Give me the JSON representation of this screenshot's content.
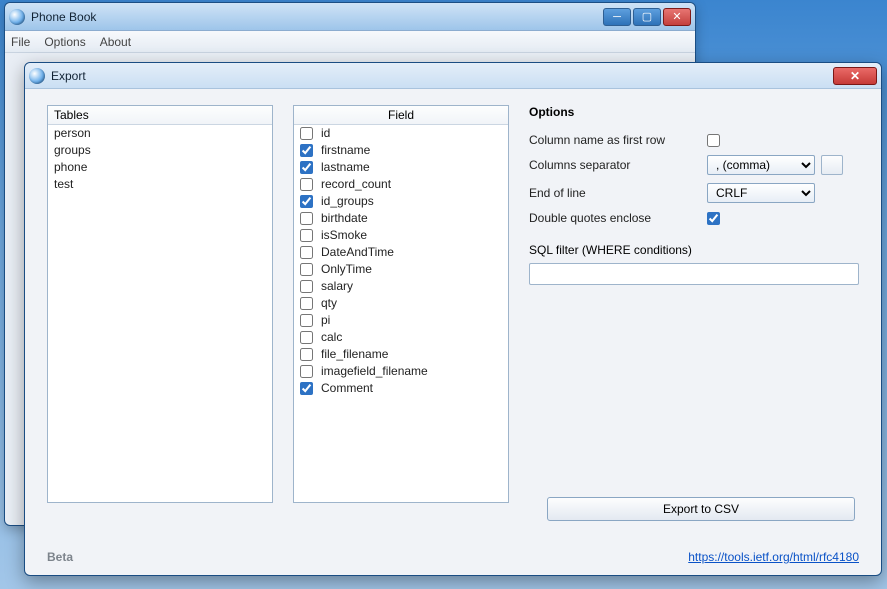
{
  "parent": {
    "title": "Phone Book",
    "menu": [
      "File",
      "Options",
      "About"
    ]
  },
  "dialog": {
    "title": "Export",
    "tables_header": "Tables",
    "fields_header": "Field",
    "tables": [
      "person",
      "groups",
      "phone",
      "test"
    ],
    "fields": [
      {
        "label": "id",
        "checked": false
      },
      {
        "label": "firstname",
        "checked": true
      },
      {
        "label": "lastname",
        "checked": true
      },
      {
        "label": "record_count",
        "checked": false
      },
      {
        "label": "id_groups",
        "checked": true
      },
      {
        "label": "birthdate",
        "checked": false
      },
      {
        "label": "isSmoke",
        "checked": false
      },
      {
        "label": "DateAndTime",
        "checked": false
      },
      {
        "label": "OnlyTime",
        "checked": false
      },
      {
        "label": "salary",
        "checked": false
      },
      {
        "label": "qty",
        "checked": false
      },
      {
        "label": "pi",
        "checked": false
      },
      {
        "label": "calc",
        "checked": false
      },
      {
        "label": "file_filename",
        "checked": false
      },
      {
        "label": "imagefield_filename",
        "checked": false
      },
      {
        "label": "Comment",
        "checked": true
      }
    ],
    "options": {
      "heading": "Options",
      "first_row": {
        "label": "Column name as first row",
        "checked": false
      },
      "separator": {
        "label": "Columns separator",
        "value": ", (comma)"
      },
      "eol": {
        "label": "End of line",
        "value": "CRLF"
      },
      "dquote": {
        "label": "Double quotes enclose",
        "checked": true
      },
      "sql_label": "SQL filter (WHERE conditions)",
      "sql_value": ""
    },
    "export_label": "Export to CSV",
    "beta": "Beta",
    "link": "https://tools.ietf.org/html/rfc4180"
  }
}
